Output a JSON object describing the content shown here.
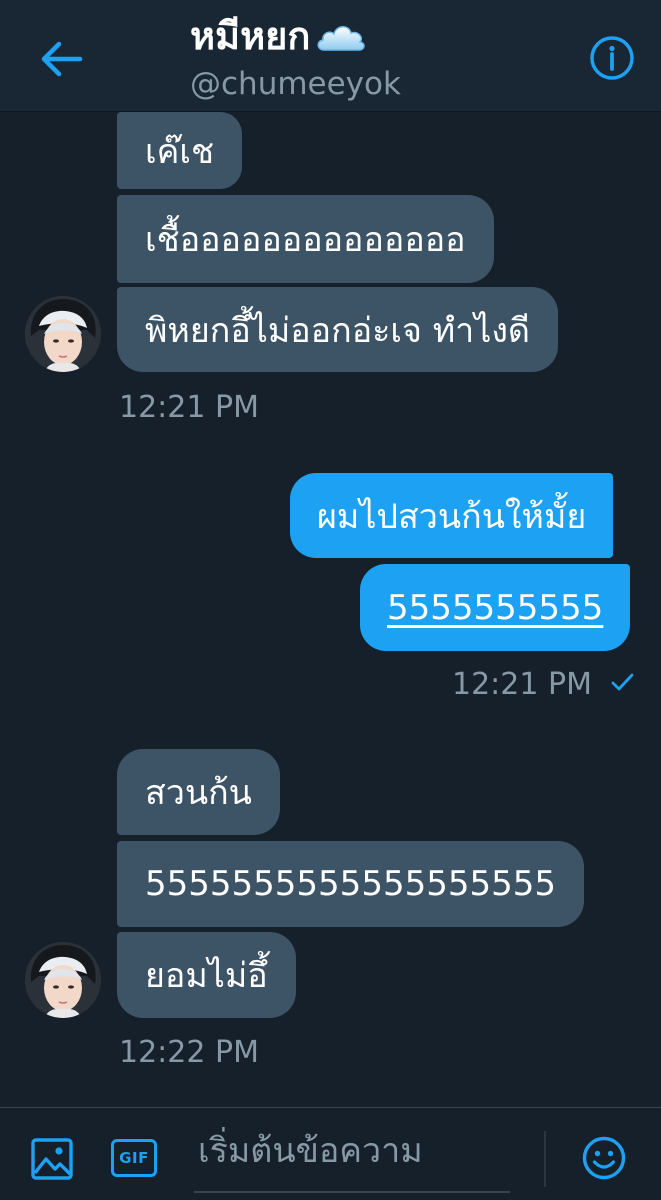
{
  "header": {
    "name": "หมีหยก",
    "handle": "@chumeeyok"
  },
  "messages": {
    "m1": "เค๊เช",
    "m2": "เชื้ออออออออออออออ",
    "m3": "พิหยกอึ้ไม่ออกอ่ะเจ ทำไงดี",
    "t1": "12:21 PM",
    "m4": "ผมไปสวนก้นให้มั้ย",
    "m5": "5555555555",
    "t2": "12:21 PM",
    "m6": "สวนก้น",
    "m7": "5555555555555555555",
    "m8": "ยอมไม่อึ้",
    "t3": "12:22 PM"
  },
  "composer": {
    "placeholder": "เริ่มต้นข้อความ",
    "gif_label": "GIF"
  },
  "colors": {
    "background": "#15202b",
    "header": "#192734",
    "incoming_bubble": "#3d5466",
    "outgoing_bubble": "#1da1f2",
    "accent": "#1da1f2",
    "muted_text": "#8899a6"
  }
}
